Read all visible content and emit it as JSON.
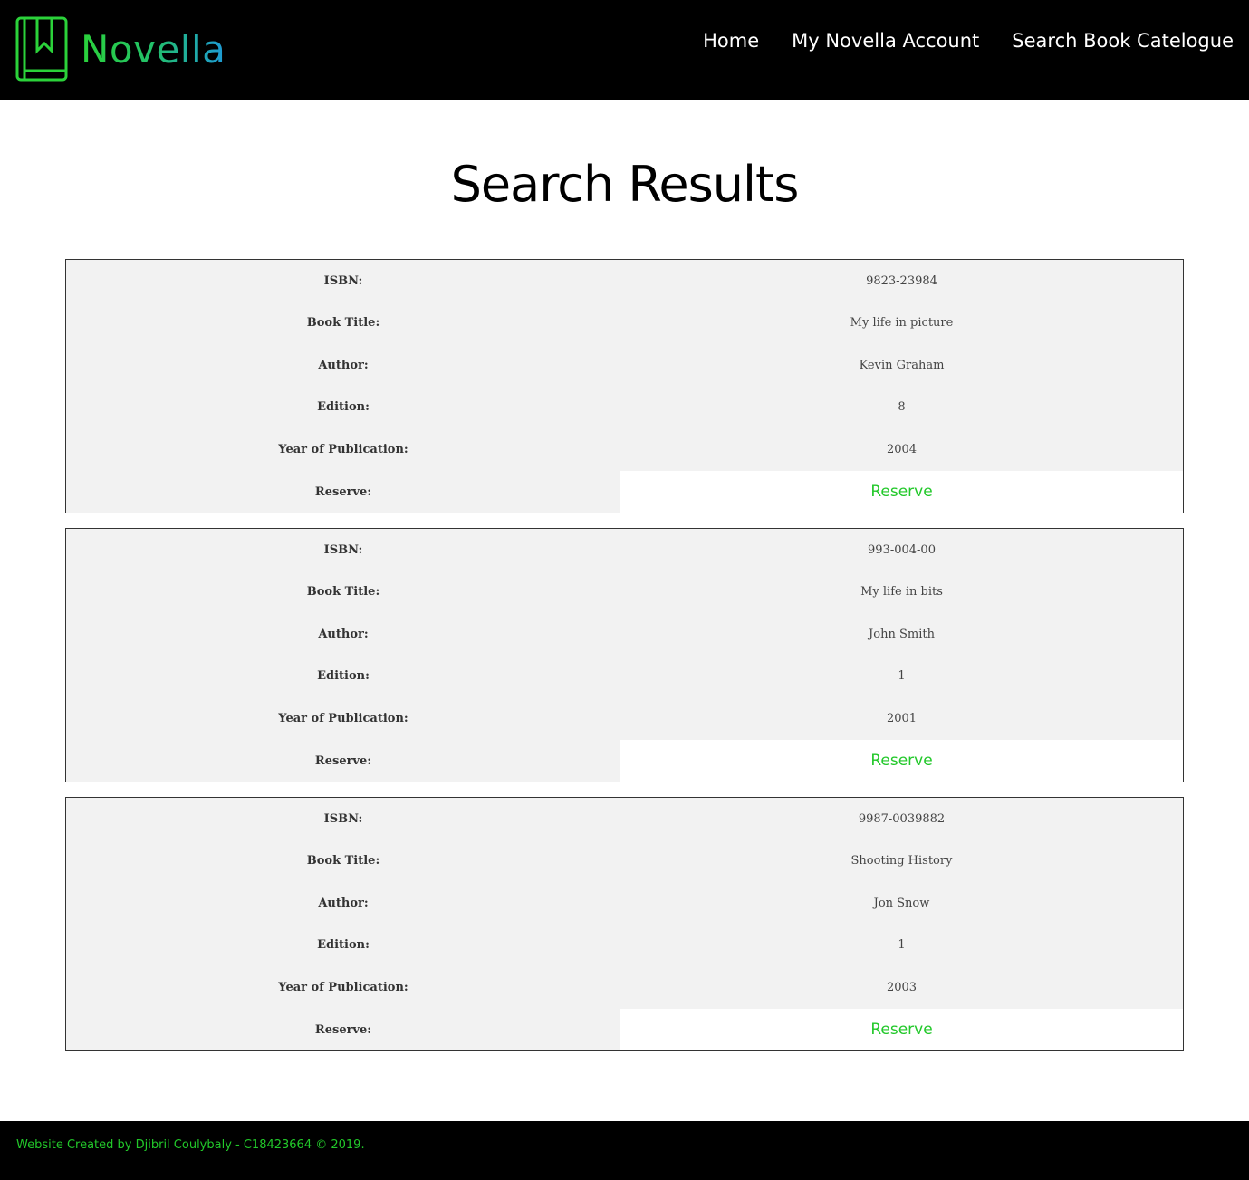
{
  "brand": {
    "name": "Novella",
    "logo_icon": "bookmark-book-icon"
  },
  "nav": {
    "items": [
      "Home",
      "My Novella Account",
      "Search Book Catelogue"
    ]
  },
  "page_title": "Search Results",
  "labels": {
    "isbn": "ISBN:",
    "title": "Book Title:",
    "author": "Author:",
    "edition": "Edition:",
    "year": "Year of Publication:",
    "reserve": "Reserve:"
  },
  "results": [
    {
      "isbn": "9823-23984",
      "title": "My life in picture",
      "author": "Kevin Graham",
      "edition": "8",
      "year": "2004",
      "reserve_label": "Reserve"
    },
    {
      "isbn": "993-004-00",
      "title": "My life in bits",
      "author": "John Smith",
      "edition": "1",
      "year": "2001",
      "reserve_label": "Reserve"
    },
    {
      "isbn": "9987-0039882",
      "title": "Shooting History",
      "author": "Jon Snow",
      "edition": "1",
      "year": "2003",
      "reserve_label": "Reserve"
    }
  ],
  "footer": {
    "text": "Website Created by Djibril Coulybaly - C18423664 © 2019."
  },
  "colors": {
    "accent_green": "#22c82a",
    "header_bg": "#000000",
    "card_bg": "#f2f2f2"
  }
}
